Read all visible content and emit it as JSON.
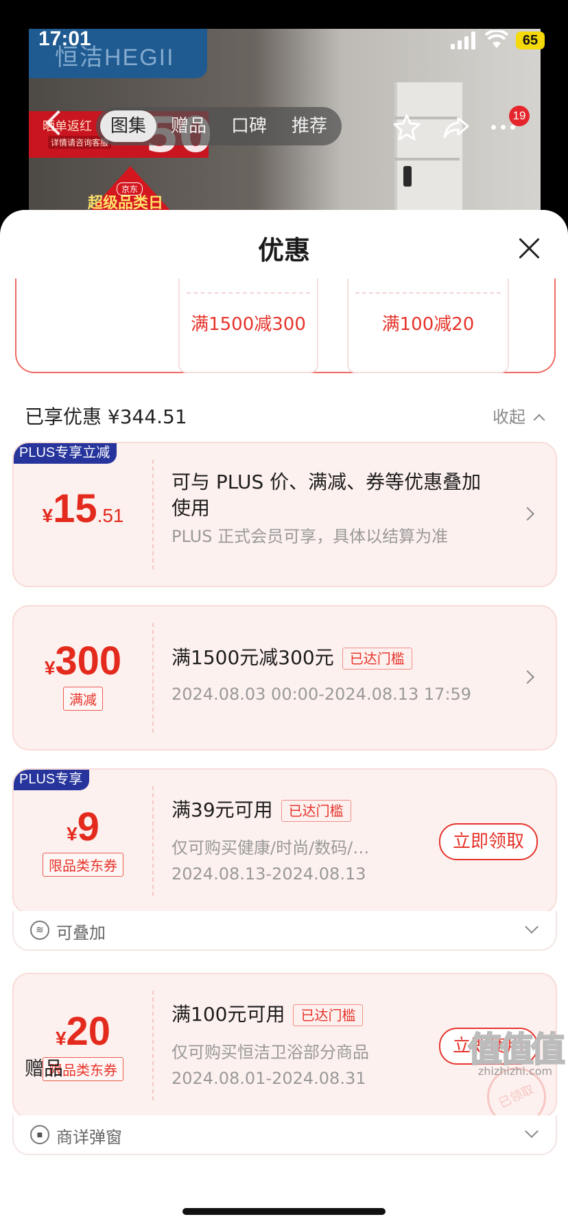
{
  "status_bar": {
    "time": "17:01",
    "battery": "65"
  },
  "background": {
    "brand": "恒洁HEGII",
    "promo_line1": "晒单返红",
    "promo_line2": "详情请咨询客服",
    "promo_big": "50",
    "promo_tri_small": "京东",
    "promo_tri_text": "超级品类日"
  },
  "nav": {
    "tabs": [
      "图集",
      "赠品",
      "口碑",
      "推荐"
    ],
    "active_tab": "图集",
    "badge_count": "19"
  },
  "sheet": {
    "title": "优惠",
    "top_coupons": [
      "满1500减300",
      "满100减20"
    ],
    "enjoyed_label": "已享优惠 ¥344.51",
    "collapse_label": "收起",
    "gifts_title": "赠品"
  },
  "cards": [
    {
      "tag": "PLUS专享立减",
      "yen": "¥",
      "int": "15",
      "dec": ".51",
      "title": "可与 PLUS 价、满减、券等优惠叠加使用",
      "sub": "PLUS 正式会员可享，具体以结算为准"
    },
    {
      "yen": "¥",
      "int": "300",
      "chip": "满减",
      "title": "满1500元减300元",
      "met": "已达门槛",
      "sub": "2024.08.03 00:00-2024.08.13 17:59"
    },
    {
      "tag": "PLUS专享",
      "yen": "¥",
      "int": "9",
      "chip": "限品类东券",
      "title": "满39元可用",
      "met": "已达门槛",
      "sub": "仅可购买健康/时尚/数码/…",
      "date": "2024.08.13-2024.08.13",
      "action": "立即领取",
      "foot": "可叠加"
    },
    {
      "yen": "¥",
      "int": "20",
      "chip": "限品类东券",
      "title": "满100元可用",
      "met": "已达门槛",
      "sub": "仅可购买恒洁卫浴部分商品",
      "date": "2024.08.01-2024.08.31",
      "action": "立即使用",
      "stamp": "已领取",
      "foot": "商详弹窗"
    }
  ],
  "watermark": {
    "main": "值值值",
    "sub": "zhizhizhi.com"
  }
}
